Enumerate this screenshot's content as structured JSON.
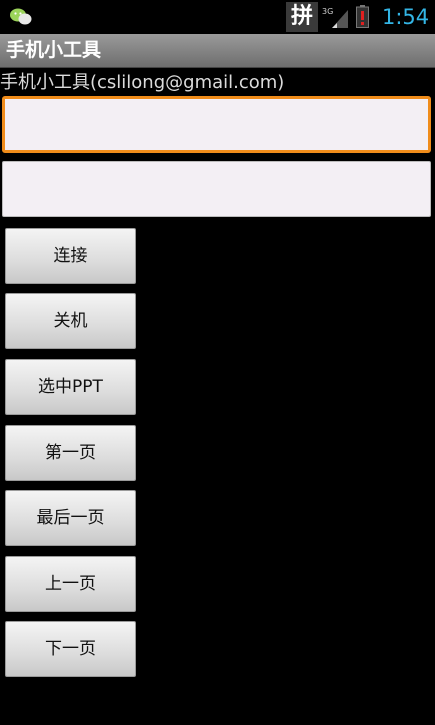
{
  "status_bar": {
    "ime_label": "拼",
    "network_label": "3G",
    "time": "1:54",
    "time_color": "#33b5e5"
  },
  "title_bar": {
    "title": "手机小工具"
  },
  "header": {
    "text": "手机小工具(cslilong@gmail.com)"
  },
  "inputs": [
    {
      "value": "",
      "placeholder": ""
    },
    {
      "value": "",
      "placeholder": ""
    }
  ],
  "buttons": [
    {
      "label": "连接"
    },
    {
      "label": "关机"
    },
    {
      "label": "选中PPT"
    },
    {
      "label": "第一页"
    },
    {
      "label": "最后一页"
    },
    {
      "label": "上一页"
    },
    {
      "label": "下一页"
    }
  ],
  "colors": {
    "focus_border": "#f08c1a",
    "input_bg": "#f3eff4"
  }
}
